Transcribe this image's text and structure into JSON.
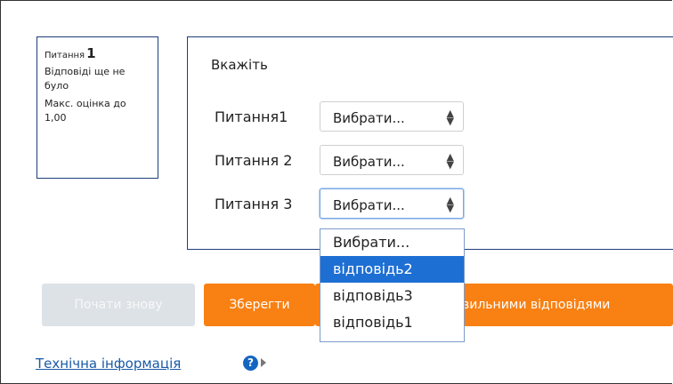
{
  "info": {
    "question_label": "Питання",
    "question_number": "1",
    "status": "Відповіді ще не було",
    "max_mark": "Макс. оцінка до 1,00"
  },
  "question": {
    "prompt": "Вкажіть",
    "rows": [
      {
        "label": "Питання1",
        "selected": "Вибрати..."
      },
      {
        "label": "Питання 2",
        "selected": "Вибрати..."
      },
      {
        "label": "Питання 3",
        "selected": "Вибрати..."
      }
    ],
    "arrow_icon": "up-down-caret-icon"
  },
  "dropdown": {
    "options": [
      "Вибрати...",
      "відповідь2",
      "відповідь3",
      "відповідь1"
    ],
    "highlighted_index": 1
  },
  "buttons": {
    "restart": "Почати знову",
    "save": "Зберегти",
    "submit_visible": "вильними відповідями"
  },
  "footer": {
    "tech_info": "Технічна інформація",
    "help_icon": "question-circle-icon",
    "expand_icon": "caret-right-icon"
  },
  "colors": {
    "accent_orange": "#f98012",
    "highlight_blue": "#1e6fd3",
    "border_blue": "#1f3f7a",
    "disabled_gray": "#dde2e6"
  }
}
